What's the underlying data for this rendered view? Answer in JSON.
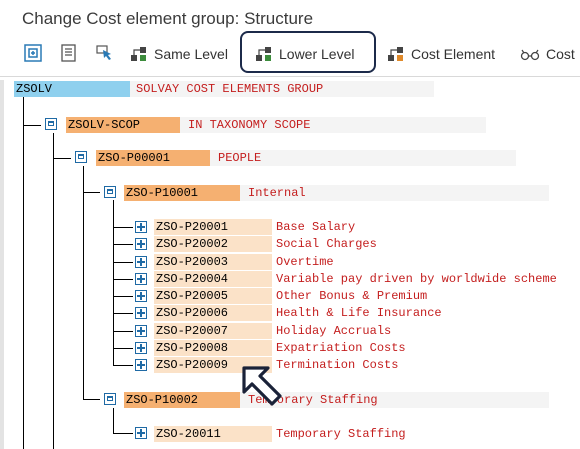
{
  "window": {
    "title": "Change Cost element group: Structure"
  },
  "toolbar": {
    "same_level": "Same Level",
    "lower_level": "Lower Level",
    "cost_element": "Cost Element",
    "cost_more": "Cost"
  },
  "tree": {
    "root": {
      "code": "ZSOLV",
      "desc": "SOLVAY COST ELEMENTS GROUP"
    },
    "scope": {
      "code": "ZSOLV-SCOP",
      "desc": "IN TAXONOMY SCOPE"
    },
    "people": {
      "code": "ZSO-P00001",
      "desc": "PEOPLE"
    },
    "internal": {
      "code": "ZSO-P10001",
      "desc": "Internal"
    },
    "elements": [
      {
        "code": "ZSO-P20001",
        "desc": "Base Salary"
      },
      {
        "code": "ZSO-P20002",
        "desc": "Social Charges"
      },
      {
        "code": "ZSO-P20003",
        "desc": "Overtime"
      },
      {
        "code": "ZSO-P20004",
        "desc": "Variable pay driven by worldwide scheme"
      },
      {
        "code": "ZSO-P20005",
        "desc": "Other Bonus & Premium"
      },
      {
        "code": "ZSO-P20006",
        "desc": "Health & Life Insurance"
      },
      {
        "code": "ZSO-P20007",
        "desc": "Holiday Accruals"
      },
      {
        "code": "ZSO-P20008",
        "desc": "Expatriation Costs"
      },
      {
        "code": "ZSO-P20009",
        "desc": "Termination Costs"
      }
    ],
    "temp": {
      "code": "ZSO-P10002",
      "desc": "Temporary Staffing"
    },
    "temp_elements": [
      {
        "code": "ZSO-20011",
        "desc": "Temporary Staffing"
      }
    ]
  },
  "colors": {
    "root_code_bg": "#8fd0ee",
    "group_code_bg": "#f5b071",
    "leaf_code_bg": "#fbe2c8",
    "desc_text": "#c41e1e",
    "highlight_border": "#1c2a4a"
  }
}
